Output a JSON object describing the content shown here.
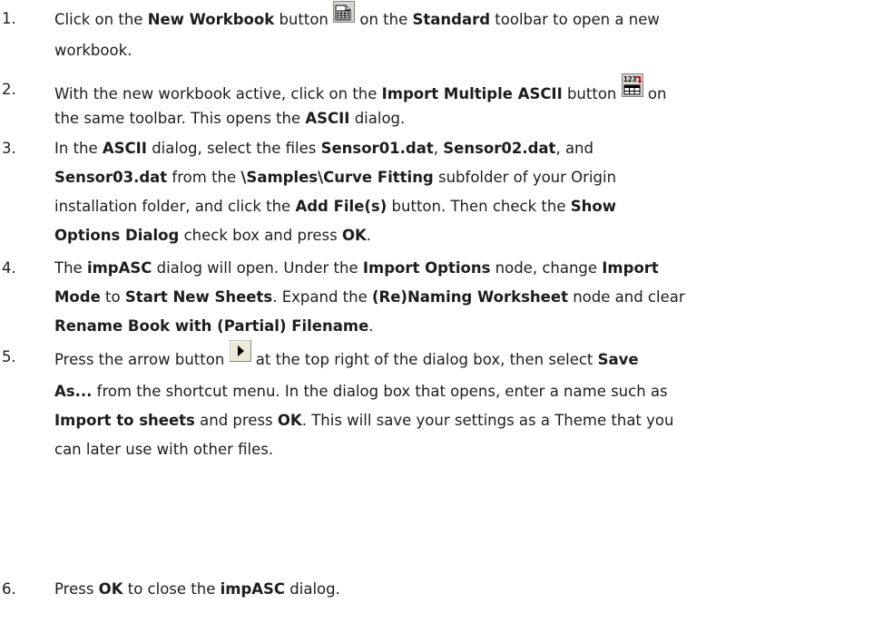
{
  "steps": [
    {
      "number": "1.",
      "lines": [
        [
          {
            "t": "Click on the "
          },
          {
            "t": "New Workbook",
            "b": true
          },
          {
            "t": " button "
          },
          {
            "icon": "new-workbook-icon"
          },
          {
            "t": " on the "
          },
          {
            "t": "Standard",
            "b": true
          },
          {
            "t": " toolbar to open a new"
          }
        ],
        [
          {
            "t": "workbook."
          }
        ]
      ]
    },
    {
      "number": "2.",
      "lines": [
        [
          {
            "t": "With the new workbook active, click on the "
          },
          {
            "t": "Import Multiple ASCII",
            "b": true
          },
          {
            "t": " button "
          },
          {
            "icon": "import-multiple-ascii-icon"
          },
          {
            "t": " on"
          }
        ],
        [
          {
            "t": "the same toolbar. This opens the "
          },
          {
            "t": "ASCII",
            "b": true
          },
          {
            "t": " dialog."
          }
        ]
      ]
    },
    {
      "number": "3.",
      "lines": [
        [
          {
            "t": "In the "
          },
          {
            "t": "ASCII",
            "b": true
          },
          {
            "t": " dialog, select the files "
          },
          {
            "t": "Sensor01.dat",
            "b": true
          },
          {
            "t": ", "
          },
          {
            "t": "Sensor02.dat",
            "b": true
          },
          {
            "t": ", and"
          }
        ],
        [
          {
            "t": "Sensor03.dat",
            "b": true
          },
          {
            "t": " from the "
          },
          {
            "t": "\\Samples\\Curve Fitting",
            "b": true
          },
          {
            "t": " subfolder of your Origin"
          }
        ],
        [
          {
            "t": "installation folder, and click the "
          },
          {
            "t": "Add File(s)",
            "b": true
          },
          {
            "t": " button. Then check the "
          },
          {
            "t": "Show",
            "b": true
          }
        ],
        [
          {
            "t": "Options Dialog",
            "b": true
          },
          {
            "t": " check box and press "
          },
          {
            "t": "OK",
            "b": true
          },
          {
            "t": "."
          }
        ]
      ]
    },
    {
      "number": "4.",
      "lines": [
        [
          {
            "t": "The "
          },
          {
            "t": "impASC",
            "b": true
          },
          {
            "t": " dialog will open. Under the "
          },
          {
            "t": "Import Options",
            "b": true
          },
          {
            "t": " node, change "
          },
          {
            "t": "Import",
            "b": true
          }
        ],
        [
          {
            "t": "Mode",
            "b": true
          },
          {
            "t": " to "
          },
          {
            "t": "Start New Sheets",
            "b": true
          },
          {
            "t": ". Expand the "
          },
          {
            "t": "(Re)Naming Worksheet",
            "b": true
          },
          {
            "t": " node and clear"
          }
        ],
        [
          {
            "t": "Rename Book with (Partial) Filename",
            "b": true
          },
          {
            "t": "."
          }
        ]
      ]
    },
    {
      "number": "5.",
      "lines": [
        [
          {
            "t": "Press the arrow button "
          },
          {
            "icon": "arrow-button-icon"
          },
          {
            "t": " at the top right of the dialog box, then select "
          },
          {
            "t": "Save",
            "b": true
          }
        ],
        [
          {
            "t": "As...",
            "b": true
          },
          {
            "t": " from the shortcut menu. In the dialog box that opens, enter a name such as"
          }
        ],
        [
          {
            "t": "Import to sheets",
            "b": true
          },
          {
            "t": " and press "
          },
          {
            "t": "OK",
            "b": true
          },
          {
            "t": ". This will save your settings as a Theme that you"
          }
        ],
        [
          {
            "t": "can later use with other files."
          }
        ]
      ]
    },
    {
      "number": "6.",
      "lines": [
        [
          {
            "t": "Press "
          },
          {
            "t": "OK",
            "b": true
          },
          {
            "t": " to close the "
          },
          {
            "t": "impASC",
            "b": true
          },
          {
            "t": " dialog."
          }
        ]
      ]
    }
  ]
}
